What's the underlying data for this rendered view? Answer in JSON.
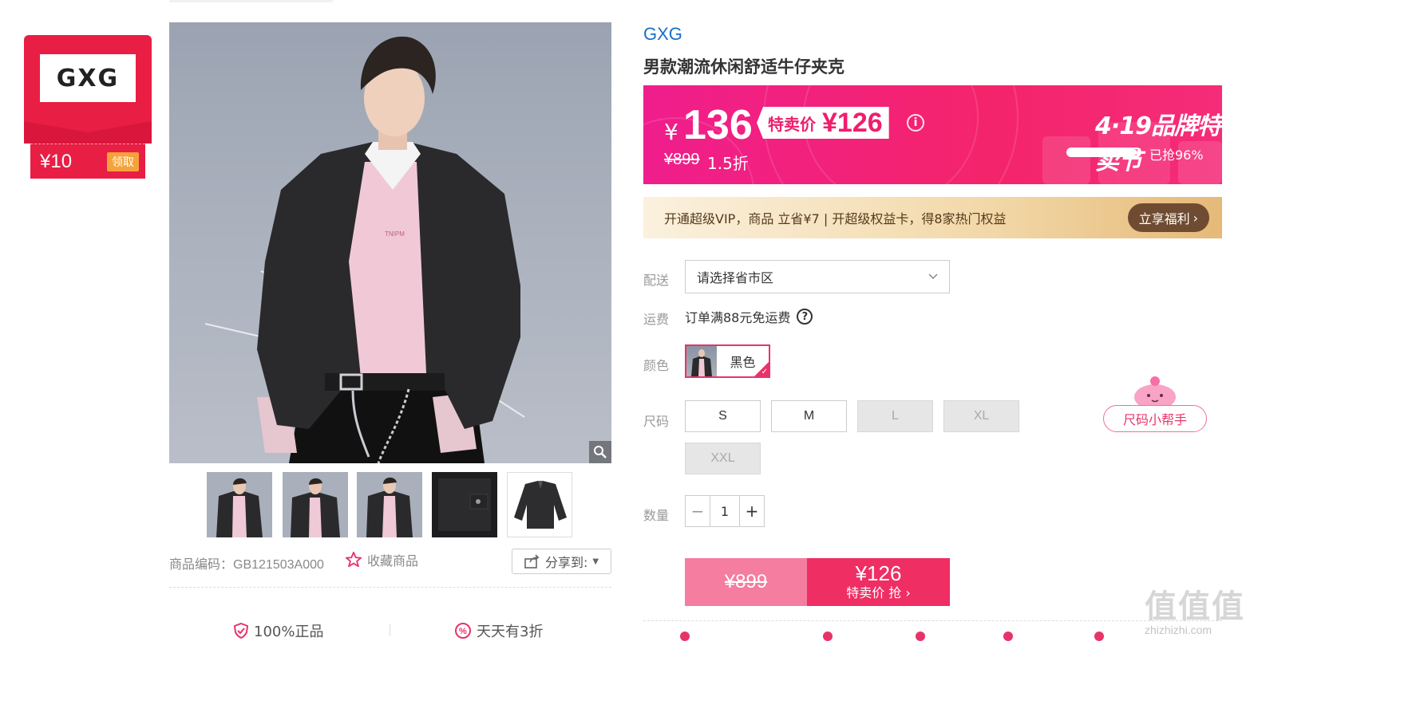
{
  "coupon": {
    "logo_text": "GXG",
    "amount": "¥10",
    "claim_label": "领取"
  },
  "gallery": {
    "main_image_alt": "model-wearing-black-denim-jacket",
    "shirt_print": "TNIPM",
    "thumbnail_count": 5
  },
  "product_meta": {
    "code_label": "商品编码：",
    "code_value": "GB121503A000",
    "favorite_label": "收藏商品",
    "share_label": "分享到:"
  },
  "guarantees": {
    "authentic": "100%正品",
    "discount": "天天有3折"
  },
  "product": {
    "brand": "GXG",
    "title": "男款潮流休闲舒适牛仔夹克"
  },
  "price_band": {
    "currency": "¥",
    "price": "136",
    "special_label": "特卖价",
    "special_price": "¥126",
    "original_price": "¥899",
    "discount_text": "1.5折",
    "festival_title": "4·19品牌特卖节",
    "grabbed_text": "已抢96%",
    "grabbed_fraction": 0.96
  },
  "vip": {
    "text": "开通超级VIP，商品 立省¥7 | 开超级权益卡，得8家热门权益",
    "button_label": "立享福利"
  },
  "options": {
    "delivery_label": "配送",
    "delivery_placeholder": "请选择省市区",
    "shipping_label": "运费",
    "shipping_text": "订单满88元免运费",
    "shipping_help": "?",
    "color_label": "颜色",
    "color_value": "黑色",
    "size_label": "尺码",
    "sizes": [
      {
        "label": "S",
        "available": true
      },
      {
        "label": "M",
        "available": true
      },
      {
        "label": "L",
        "available": false
      },
      {
        "label": "XL",
        "available": false
      },
      {
        "label": "XXL",
        "available": false
      }
    ],
    "size_helper_label": "尺码小帮手",
    "quantity_label": "数量",
    "quantity_value": "1",
    "minus": "−",
    "plus": "+"
  },
  "buy": {
    "original_price": "¥899",
    "special_price": "¥126",
    "button_label": "特卖价 抢"
  },
  "watermark": {
    "title": "值值值",
    "url": "zhizhizhi.com"
  },
  "colors": {
    "accent": "#e8336a",
    "brand_link": "#1a6fc9",
    "price_band": "#f01e8c",
    "vip_button": "#6f4c31"
  }
}
